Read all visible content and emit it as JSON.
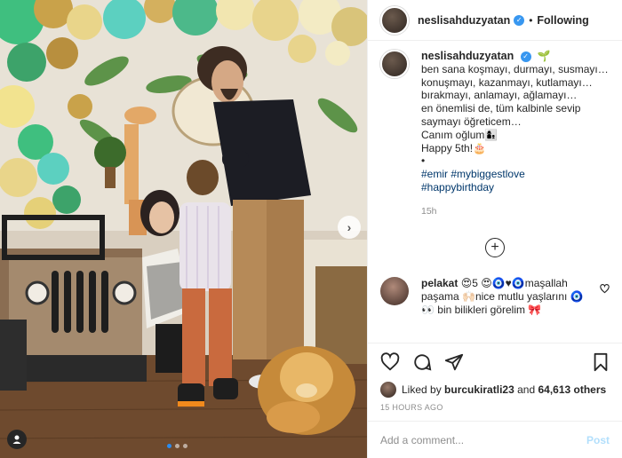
{
  "header": {
    "username": "neslisahduzyatan",
    "separator": "•",
    "follow_label": "Following"
  },
  "caption": {
    "username": "neslisahduzyatan",
    "lines": [
      "ben sana koşmayı, durmayı, susmayı…",
      "konuşmayı, kazanmayı, kutlamayı…",
      "bırakmayı, anlamayı, ağlamayı…",
      "en önemlisi de, tüm kalbinle sevip",
      "saymayı öğreticem…",
      "Canım oğlum👩‍👦",
      "Happy 5th!🎂",
      "•"
    ],
    "hashtags_line1": [
      "#emir",
      "#mybiggestlove"
    ],
    "hashtags_line2": [
      "#happybirthday"
    ],
    "time": "15h"
  },
  "comment": {
    "username": "pelakat",
    "text": "😍5 😍🧿♥🧿maşallah paşama 🙌🏻nice mutlu yaşlarını 🧿👀 bin bilikleri görelim 🎀"
  },
  "likes": {
    "liked_by_prefix": "Liked by",
    "liked_by_user": "burcukiratli23",
    "and": "and",
    "others": "64,613 others"
  },
  "posted": "15 HOURS AGO",
  "add_comment": {
    "placeholder": "Add a comment...",
    "post_label": "Post"
  },
  "carousel": {
    "count": 3,
    "active_index": 0
  },
  "colors": {
    "link": "#00376b",
    "verified": "#3897f0",
    "post_disabled": "#b2dffc",
    "meta_gray": "#8e8e8e"
  }
}
